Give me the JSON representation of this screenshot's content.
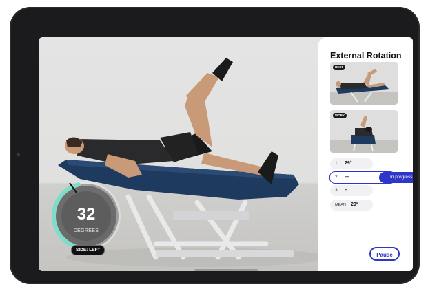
{
  "video": {
    "gauge_value": "32",
    "gauge_unit": "DEGREES",
    "gauge_fraction": 0.55,
    "side_label": "SIDE: LEFT"
  },
  "panel": {
    "title": "External Rotation",
    "thumbnails": [
      {
        "badge": "BEST"
      },
      {
        "badge": "WORK"
      }
    ],
    "reps": [
      {
        "num": "1",
        "value": "29°"
      },
      {
        "num": "2",
        "value": "—",
        "status": "In progress"
      },
      {
        "num": "3",
        "value": "–"
      }
    ],
    "mean_label": "MEAN",
    "mean_value": "29°",
    "pause_label": "Pause"
  },
  "colors": {
    "accent": "#2f35c7",
    "table": "#1f3a5f",
    "gauge_track": "#7fdcc8"
  },
  "icons": [
    "gauge-ring-icon"
  ]
}
